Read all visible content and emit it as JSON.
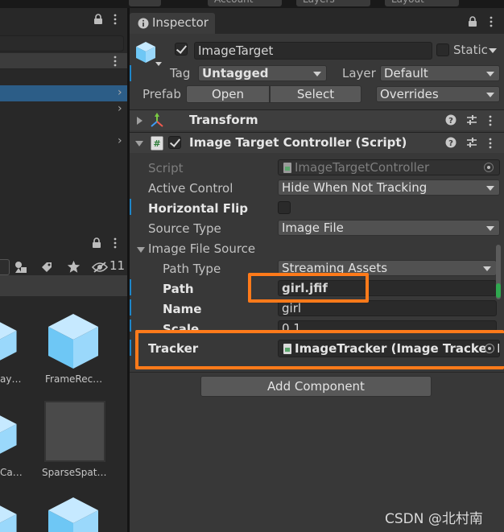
{
  "top_bar": {
    "buttons": [
      "Account",
      "Layers",
      "Layout"
    ]
  },
  "hierarchy": {
    "lock": "lock-icon",
    "menu": "kebab-icon"
  },
  "project": {
    "hidden_count": "11",
    "assets": [
      {
        "label": "ay…",
        "icon": "cube-icon"
      },
      {
        "label": "FrameRec…",
        "icon": "cube-icon"
      },
      {
        "label": "Ca…",
        "icon": "cube-icon"
      },
      {
        "label": "SparseSpat…",
        "icon": "blank-thumbnail"
      },
      {
        "label": "",
        "icon": "cube-icon"
      },
      {
        "label": "",
        "icon": "cube-icon"
      }
    ]
  },
  "inspector": {
    "tab_label": "Inspector",
    "object": {
      "name": "ImageTarget",
      "static_label": "Static",
      "tag_label": "Tag",
      "tag_value": "Untagged",
      "layer_label": "Layer",
      "layer_value": "Default",
      "prefab_label": "Prefab",
      "prefab_open": "Open",
      "prefab_select": "Select",
      "prefab_overrides": "Overrides"
    },
    "transform": {
      "title": "Transform"
    },
    "script_component": {
      "title": "Image Target Controller (Script)",
      "rows": {
        "script_label": "Script",
        "script_value": "ImageTargetController",
        "active_control_label": "Active Control",
        "active_control_value": "Hide When Not Tracking",
        "horizontal_flip_label": "Horizontal Flip",
        "source_type_label": "Source Type",
        "source_type_value": "Image File",
        "image_file_source_label": "Image File Source",
        "path_type_label": "Path Type",
        "path_type_value": "Streaming Assets",
        "path_label": "Path",
        "path_value": "girl.jfif",
        "name_label": "Name",
        "name_value": "girl",
        "scale_label": "Scale",
        "scale_value": "0.1",
        "tracker_label": "Tracker",
        "tracker_value": "ImageTracker (Image Tracker F"
      }
    },
    "add_component": "Add Component"
  },
  "accent_colors": {
    "highlight": "#ff7a1a",
    "selection": "#2c5d87",
    "modified": "#1e86c9"
  },
  "watermark": "CSDN @北村南"
}
